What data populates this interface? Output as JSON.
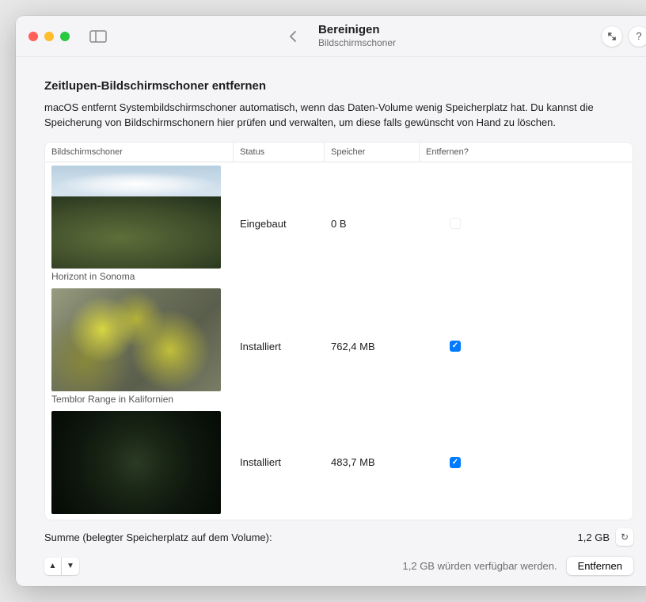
{
  "titlebar": {
    "title": "Bereinigen",
    "subtitle": "Bildschirmschoner"
  },
  "page": {
    "heading": "Zeitlupen-Bildschirmschoner entfernen",
    "description": "macOS entfernt Systembildschirmschoner automatisch, wenn das Daten-Volume wenig Speicherplatz hat. Du kannst die Speicherung von Bildschirmschonern hier prüfen und verwalten, um diese falls gewünscht von Hand zu löschen."
  },
  "columns": {
    "saver": "Bildschirmschoner",
    "status": "Status",
    "storage": "Speicher",
    "delete": "Entfernen?"
  },
  "items": [
    {
      "name": "Horizont in Sonoma",
      "status": "Eingebaut",
      "storage": "0  B",
      "checked": false,
      "enabled": false,
      "thumbClass": "thumb-sonoma"
    },
    {
      "name": "Temblor Range in Kalifornien",
      "status": "Installiert",
      "storage": "762,4 MB",
      "checked": true,
      "enabled": true,
      "thumbClass": "thumb-temblor"
    },
    {
      "name": "",
      "status": "Installiert",
      "storage": "483,7 MB",
      "checked": true,
      "enabled": true,
      "thumbClass": "thumb-forest"
    }
  ],
  "footer": {
    "sum_label": "Summe (belegter Speicherplatz auf dem Volume):",
    "sum_value": "1,2 GB",
    "space_available": "1,2 GB würden verfügbar werden.",
    "remove_button": "Entfernen"
  },
  "icons": {
    "help": "?",
    "refresh": "↻"
  }
}
